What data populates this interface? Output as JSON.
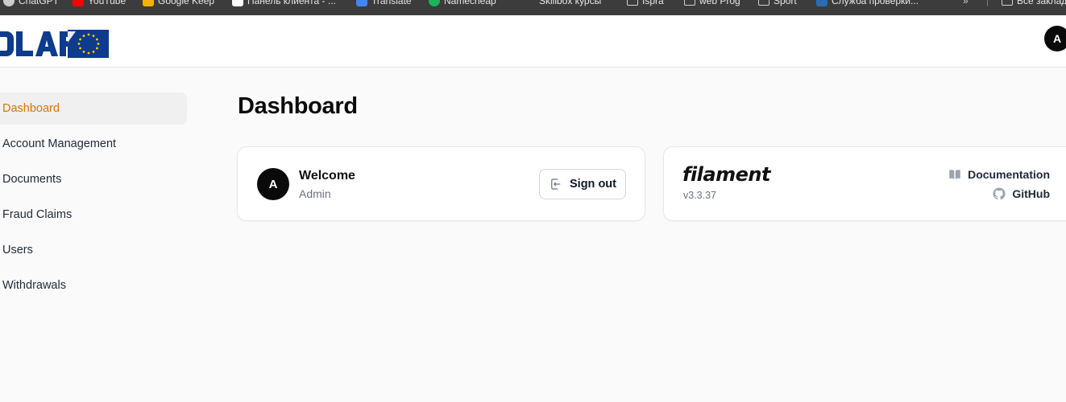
{
  "bookmarks": [
    {
      "label": "ChatGPT",
      "color": "#cccccc"
    },
    {
      "label": "YouTube",
      "color": "#ff0000"
    },
    {
      "label": "Google Keep",
      "color": "#f4b400"
    },
    {
      "label": "Панель клиента - ...",
      "color": "#ffffff"
    },
    {
      "label": "Translate",
      "color": "#4285f4"
    },
    {
      "label": "Namecheap",
      "color": "#1bb55c"
    },
    {
      "label": "Skillbox курсы",
      "color": "#cccccc"
    },
    {
      "label": "Ispra",
      "color": "folder"
    },
    {
      "label": "web Prog",
      "color": "folder"
    },
    {
      "label": "Sport",
      "color": "folder"
    },
    {
      "label": "Служба проверки...",
      "color": "#2b6cb0"
    },
    {
      "label": "Все закладки",
      "color": "folder"
    }
  ],
  "header": {
    "logo_text": "OLAF",
    "user_initial": "A"
  },
  "sidebar": {
    "items": [
      {
        "label": "Dashboard",
        "active": true
      },
      {
        "label": "Account Management",
        "active": false
      },
      {
        "label": "Documents",
        "active": false
      },
      {
        "label": "Fraud Claims",
        "active": false
      },
      {
        "label": "Users",
        "active": false
      },
      {
        "label": "Withdrawals",
        "active": false
      }
    ]
  },
  "main": {
    "title": "Dashboard",
    "welcome": {
      "initial": "A",
      "title": "Welcome",
      "subtitle": "Admin",
      "signout_label": "Sign out"
    },
    "filament": {
      "brand": "filament",
      "version": "v3.3.37",
      "docs_label": "Documentation",
      "github_label": "GitHub"
    }
  },
  "colors": {
    "accent": "#d97706",
    "eu_blue": "#0e3b8c",
    "eu_star": "#ffcc00"
  }
}
